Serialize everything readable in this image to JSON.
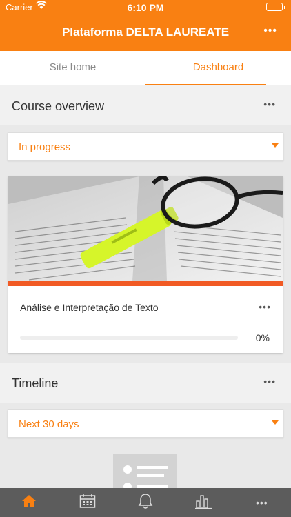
{
  "status_bar": {
    "carrier": "Carrier",
    "time": "6:10 PM",
    "battery_color": "#4cd964"
  },
  "header": {
    "title": "Plataforma DELTA LAUREATE",
    "more_icon": "more-dots-icon",
    "background": "#f98012"
  },
  "tabs": [
    {
      "label": "Site home",
      "active": false
    },
    {
      "label": "Dashboard",
      "active": true
    }
  ],
  "course_overview": {
    "title": "Course overview",
    "filter": {
      "selected": "In progress"
    },
    "courses": [
      {
        "name": "Análise e Interpretação de Texto",
        "progress_text": "0%",
        "progress_value": 0
      }
    ]
  },
  "timeline": {
    "title": "Timeline",
    "filter": {
      "selected": "Next 30 days"
    }
  },
  "bottom_nav": [
    {
      "icon": "home-icon",
      "active": true
    },
    {
      "icon": "calendar-icon",
      "active": false
    },
    {
      "icon": "bell-icon",
      "active": false
    },
    {
      "icon": "grades-chart-icon",
      "active": false
    },
    {
      "icon": "more-dots-icon",
      "active": false
    }
  ],
  "colors": {
    "accent": "#f98012",
    "card_accent": "#f15a24",
    "nav_background": "#5c5c5c"
  }
}
